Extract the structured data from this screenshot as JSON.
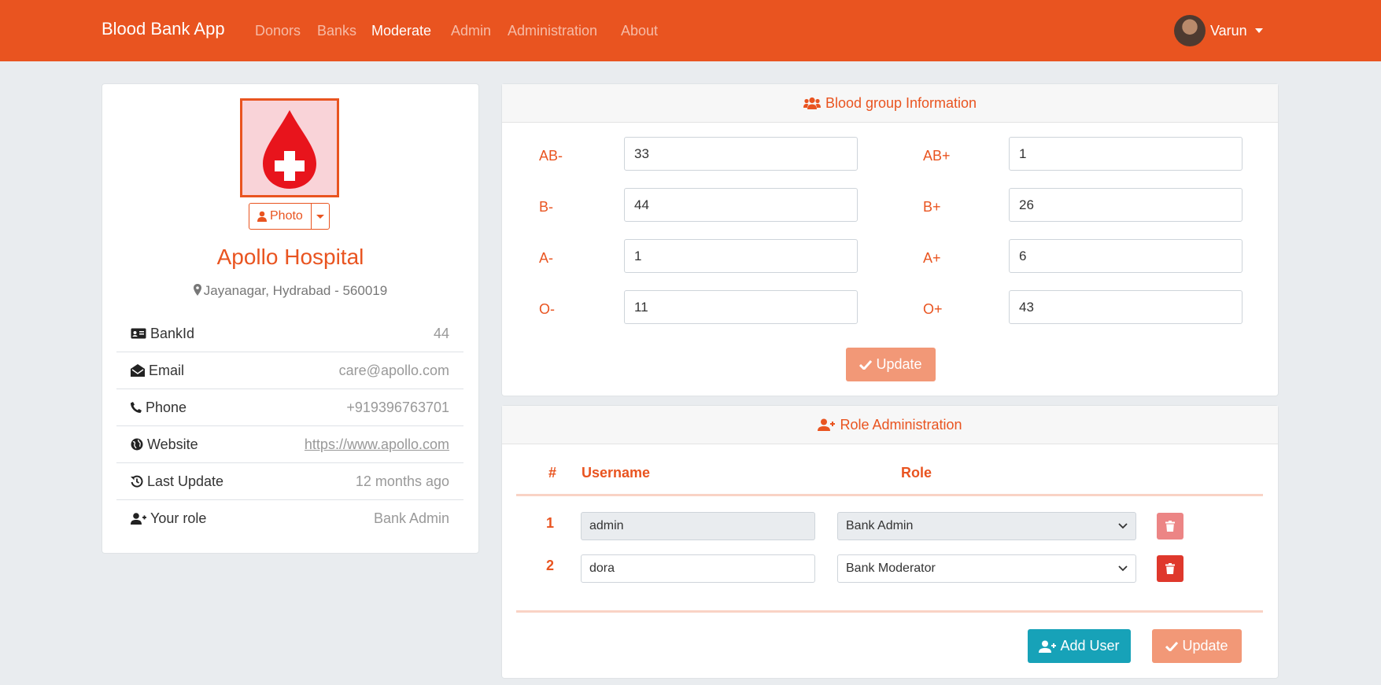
{
  "navbar": {
    "brand": "Blood Bank App",
    "links": [
      "Donors",
      "Banks",
      "Moderate",
      "Admin",
      "Administration",
      "About"
    ],
    "active": "Moderate",
    "user": "Varun"
  },
  "bank": {
    "photo_button": "Photo",
    "name": "Apollo Hospital",
    "address": "Jayanagar, Hydrabad - 560019",
    "details": [
      {
        "label": "BankId",
        "value": "44",
        "icon": "id-card-icon"
      },
      {
        "label": "Email",
        "value": "care@apollo.com",
        "icon": "envelope-open-icon"
      },
      {
        "label": "Phone",
        "value": "+919396763701",
        "icon": "phone-icon"
      },
      {
        "label": "Website",
        "value": "https://www.apollo.com",
        "icon": "globe-icon"
      },
      {
        "label": "Last Update",
        "value": "12 months ago",
        "icon": "history-icon"
      },
      {
        "label": "Your role",
        "value": "Bank Admin",
        "icon": "user-plus-icon"
      }
    ]
  },
  "blood_groups": {
    "title": "Blood group Information",
    "groups": [
      {
        "label": "AB-",
        "value": "33"
      },
      {
        "label": "AB+",
        "value": "1"
      },
      {
        "label": "B-",
        "value": "44"
      },
      {
        "label": "B+",
        "value": "26"
      },
      {
        "label": "A-",
        "value": "1"
      },
      {
        "label": "A+",
        "value": "6"
      },
      {
        "label": "O-",
        "value": "11"
      },
      {
        "label": "O+",
        "value": "43"
      }
    ],
    "update_label": "Update"
  },
  "roles": {
    "title": "Role Administration",
    "headers": {
      "index": "#",
      "username": "Username",
      "role": "Role"
    },
    "rows": [
      {
        "index": "1",
        "username": "admin",
        "role": "Bank Admin"
      },
      {
        "index": "2",
        "username": "dora",
        "role": "Bank Moderator"
      }
    ],
    "add_user_label": "Add User",
    "update_label": "Update"
  },
  "colors": {
    "primary": "#e95420",
    "info": "#17a2b8",
    "danger": "#df382c"
  }
}
